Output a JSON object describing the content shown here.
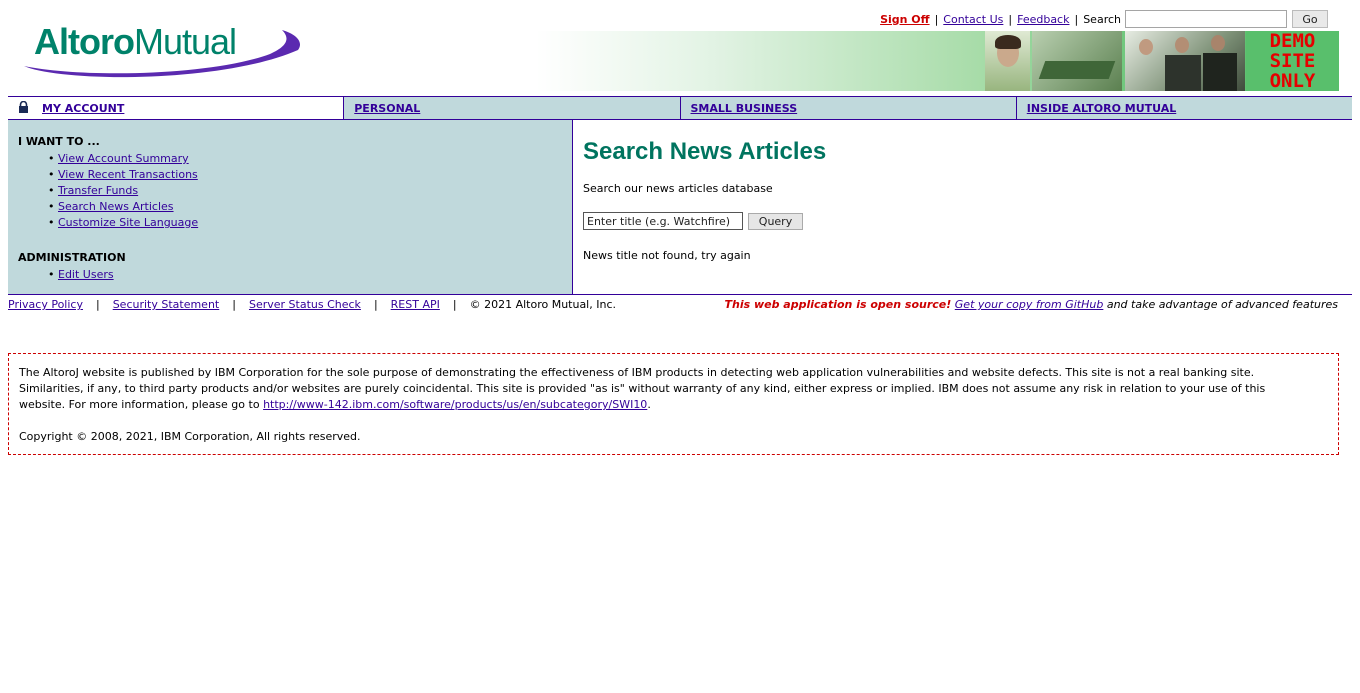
{
  "header": {
    "logo": {
      "brand_part1": "Altoro",
      "brand_part2": "Mutual"
    },
    "links": {
      "sign_off": "Sign Off",
      "contact_us": "Contact Us",
      "feedback": "Feedback",
      "separator": "|"
    },
    "search": {
      "label": "Search",
      "value": "",
      "go_label": "Go"
    },
    "banner": {
      "demo_line1": "DEMO",
      "demo_line2": "SITE",
      "demo_line3": "ONLY"
    }
  },
  "nav": {
    "tabs": [
      {
        "label": "MY ACCOUNT",
        "active": true,
        "icon": "lock-icon"
      },
      {
        "label": "PERSONAL",
        "active": false
      },
      {
        "label": "SMALL BUSINESS",
        "active": false
      },
      {
        "label": "INSIDE ALTORO MUTUAL",
        "active": false
      }
    ]
  },
  "sidebar": {
    "i_want_to": {
      "title": "I WANT TO ...",
      "items": [
        "View Account Summary",
        "View Recent Transactions",
        "Transfer Funds",
        "Search News Articles",
        "Customize Site Language"
      ]
    },
    "administration": {
      "title": "ADMINISTRATION",
      "items": [
        "Edit Users"
      ]
    }
  },
  "main": {
    "title": "Search News Articles",
    "description": "Search our news articles database",
    "query": {
      "value": "Enter title (e.g. Watchfire)",
      "button_label": "Query"
    },
    "status": "News title not found, try again"
  },
  "footer": {
    "links": [
      "Privacy Policy",
      "Security Statement",
      "Server Status Check",
      "REST API"
    ],
    "separator": "|",
    "copyright": "© 2021 Altoro Mutual, Inc.",
    "open_source_note": "This web application is open source!",
    "github_link": "Get your copy from GitHub",
    "tail": "and take advantage of advanced features"
  },
  "disclaimer": {
    "text_before_link": "The AltoroJ website is published by IBM Corporation for the sole purpose of demonstrating the effectiveness of IBM products in detecting web application vulnerabilities and website defects. This site is not a real banking site. Similarities, if any, to third party products and/or websites are purely coincidental. This site is provided \"as is\" without warranty of any kind, either express or implied. IBM does not assume any risk in relation to your use of this website. For more information, please go to",
    "link": "http://www-142.ibm.com/software/products/us/en/subcategory/SWI10",
    "text_after_link": ".",
    "copyright": "Copyright © 2008, 2021, IBM Corporation, All rights reserved."
  },
  "colors": {
    "brand_green": "#00826a",
    "brand_purple": "#5b2ab0",
    "link": "#330099",
    "nav_bg": "#c0d9dc",
    "title_green": "#00745f",
    "alert_red": "#cc0000"
  }
}
